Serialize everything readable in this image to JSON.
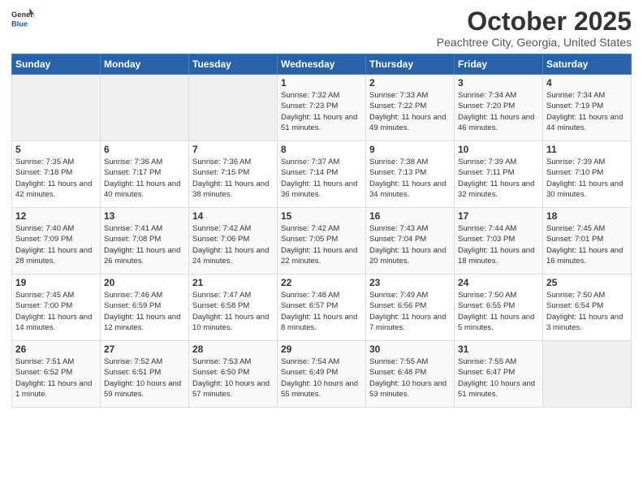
{
  "logo": {
    "general": "General",
    "blue": "Blue"
  },
  "header": {
    "month_title": "October 2025",
    "location": "Peachtree City, Georgia, United States"
  },
  "days_of_week": [
    "Sunday",
    "Monday",
    "Tuesday",
    "Wednesday",
    "Thursday",
    "Friday",
    "Saturday"
  ],
  "weeks": [
    [
      {
        "day": "",
        "sunrise": "",
        "sunset": "",
        "daylight": "",
        "empty": true
      },
      {
        "day": "",
        "sunrise": "",
        "sunset": "",
        "daylight": "",
        "empty": true
      },
      {
        "day": "",
        "sunrise": "",
        "sunset": "",
        "daylight": "",
        "empty": true
      },
      {
        "day": "1",
        "sunrise": "Sunrise: 7:32 AM",
        "sunset": "Sunset: 7:23 PM",
        "daylight": "Daylight: 11 hours and 51 minutes."
      },
      {
        "day": "2",
        "sunrise": "Sunrise: 7:33 AM",
        "sunset": "Sunset: 7:22 PM",
        "daylight": "Daylight: 11 hours and 49 minutes."
      },
      {
        "day": "3",
        "sunrise": "Sunrise: 7:34 AM",
        "sunset": "Sunset: 7:20 PM",
        "daylight": "Daylight: 11 hours and 46 minutes."
      },
      {
        "day": "4",
        "sunrise": "Sunrise: 7:34 AM",
        "sunset": "Sunset: 7:19 PM",
        "daylight": "Daylight: 11 hours and 44 minutes."
      }
    ],
    [
      {
        "day": "5",
        "sunrise": "Sunrise: 7:35 AM",
        "sunset": "Sunset: 7:18 PM",
        "daylight": "Daylight: 11 hours and 42 minutes."
      },
      {
        "day": "6",
        "sunrise": "Sunrise: 7:36 AM",
        "sunset": "Sunset: 7:17 PM",
        "daylight": "Daylight: 11 hours and 40 minutes."
      },
      {
        "day": "7",
        "sunrise": "Sunrise: 7:36 AM",
        "sunset": "Sunset: 7:15 PM",
        "daylight": "Daylight: 11 hours and 38 minutes."
      },
      {
        "day": "8",
        "sunrise": "Sunrise: 7:37 AM",
        "sunset": "Sunset: 7:14 PM",
        "daylight": "Daylight: 11 hours and 36 minutes."
      },
      {
        "day": "9",
        "sunrise": "Sunrise: 7:38 AM",
        "sunset": "Sunset: 7:13 PM",
        "daylight": "Daylight: 11 hours and 34 minutes."
      },
      {
        "day": "10",
        "sunrise": "Sunrise: 7:39 AM",
        "sunset": "Sunset: 7:11 PM",
        "daylight": "Daylight: 11 hours and 32 minutes."
      },
      {
        "day": "11",
        "sunrise": "Sunrise: 7:39 AM",
        "sunset": "Sunset: 7:10 PM",
        "daylight": "Daylight: 11 hours and 30 minutes."
      }
    ],
    [
      {
        "day": "12",
        "sunrise": "Sunrise: 7:40 AM",
        "sunset": "Sunset: 7:09 PM",
        "daylight": "Daylight: 11 hours and 28 minutes."
      },
      {
        "day": "13",
        "sunrise": "Sunrise: 7:41 AM",
        "sunset": "Sunset: 7:08 PM",
        "daylight": "Daylight: 11 hours and 26 minutes."
      },
      {
        "day": "14",
        "sunrise": "Sunrise: 7:42 AM",
        "sunset": "Sunset: 7:06 PM",
        "daylight": "Daylight: 11 hours and 24 minutes."
      },
      {
        "day": "15",
        "sunrise": "Sunrise: 7:42 AM",
        "sunset": "Sunset: 7:05 PM",
        "daylight": "Daylight: 11 hours and 22 minutes."
      },
      {
        "day": "16",
        "sunrise": "Sunrise: 7:43 AM",
        "sunset": "Sunset: 7:04 PM",
        "daylight": "Daylight: 11 hours and 20 minutes."
      },
      {
        "day": "17",
        "sunrise": "Sunrise: 7:44 AM",
        "sunset": "Sunset: 7:03 PM",
        "daylight": "Daylight: 11 hours and 18 minutes."
      },
      {
        "day": "18",
        "sunrise": "Sunrise: 7:45 AM",
        "sunset": "Sunset: 7:01 PM",
        "daylight": "Daylight: 11 hours and 16 minutes."
      }
    ],
    [
      {
        "day": "19",
        "sunrise": "Sunrise: 7:45 AM",
        "sunset": "Sunset: 7:00 PM",
        "daylight": "Daylight: 11 hours and 14 minutes."
      },
      {
        "day": "20",
        "sunrise": "Sunrise: 7:46 AM",
        "sunset": "Sunset: 6:59 PM",
        "daylight": "Daylight: 11 hours and 12 minutes."
      },
      {
        "day": "21",
        "sunrise": "Sunrise: 7:47 AM",
        "sunset": "Sunset: 6:58 PM",
        "daylight": "Daylight: 11 hours and 10 minutes."
      },
      {
        "day": "22",
        "sunrise": "Sunrise: 7:48 AM",
        "sunset": "Sunset: 6:57 PM",
        "daylight": "Daylight: 11 hours and 8 minutes."
      },
      {
        "day": "23",
        "sunrise": "Sunrise: 7:49 AM",
        "sunset": "Sunset: 6:56 PM",
        "daylight": "Daylight: 11 hours and 7 minutes."
      },
      {
        "day": "24",
        "sunrise": "Sunrise: 7:50 AM",
        "sunset": "Sunset: 6:55 PM",
        "daylight": "Daylight: 11 hours and 5 minutes."
      },
      {
        "day": "25",
        "sunrise": "Sunrise: 7:50 AM",
        "sunset": "Sunset: 6:54 PM",
        "daylight": "Daylight: 11 hours and 3 minutes."
      }
    ],
    [
      {
        "day": "26",
        "sunrise": "Sunrise: 7:51 AM",
        "sunset": "Sunset: 6:52 PM",
        "daylight": "Daylight: 11 hours and 1 minute."
      },
      {
        "day": "27",
        "sunrise": "Sunrise: 7:52 AM",
        "sunset": "Sunset: 6:51 PM",
        "daylight": "Daylight: 10 hours and 59 minutes."
      },
      {
        "day": "28",
        "sunrise": "Sunrise: 7:53 AM",
        "sunset": "Sunset: 6:50 PM",
        "daylight": "Daylight: 10 hours and 57 minutes."
      },
      {
        "day": "29",
        "sunrise": "Sunrise: 7:54 AM",
        "sunset": "Sunset: 6:49 PM",
        "daylight": "Daylight: 10 hours and 55 minutes."
      },
      {
        "day": "30",
        "sunrise": "Sunrise: 7:55 AM",
        "sunset": "Sunset: 6:48 PM",
        "daylight": "Daylight: 10 hours and 53 minutes."
      },
      {
        "day": "31",
        "sunrise": "Sunrise: 7:55 AM",
        "sunset": "Sunset: 6:47 PM",
        "daylight": "Daylight: 10 hours and 51 minutes."
      },
      {
        "day": "",
        "sunrise": "",
        "sunset": "",
        "daylight": "",
        "empty": true
      }
    ]
  ]
}
